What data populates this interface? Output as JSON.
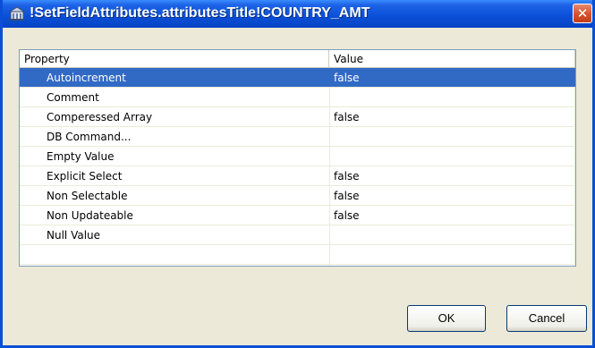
{
  "window": {
    "title": "!SetFieldAttributes.attributesTitle!COUNTRY_AMT",
    "close_glyph": "✕"
  },
  "table": {
    "columns": [
      "Property",
      "Value"
    ],
    "rows": [
      {
        "property": "Autoincrement",
        "value": "false",
        "selected": true
      },
      {
        "property": "Comment",
        "value": ""
      },
      {
        "property": "Comperessed Array",
        "value": "false"
      },
      {
        "property": "DB Command...",
        "value": ""
      },
      {
        "property": "Empty Value",
        "value": ""
      },
      {
        "property": "Explicit Select",
        "value": "false"
      },
      {
        "property": "Non Selectable",
        "value": "false"
      },
      {
        "property": "Non Updateable",
        "value": "false"
      },
      {
        "property": "Null Value",
        "value": ""
      },
      {
        "property": "",
        "value": ""
      }
    ]
  },
  "buttons": {
    "ok": "OK",
    "cancel": "Cancel"
  },
  "colors": {
    "title_bar": "#0a4fd6",
    "selection": "#316ac5",
    "dialog_bg": "#ece9d8"
  },
  "icons": {
    "title": "app-building-icon"
  }
}
